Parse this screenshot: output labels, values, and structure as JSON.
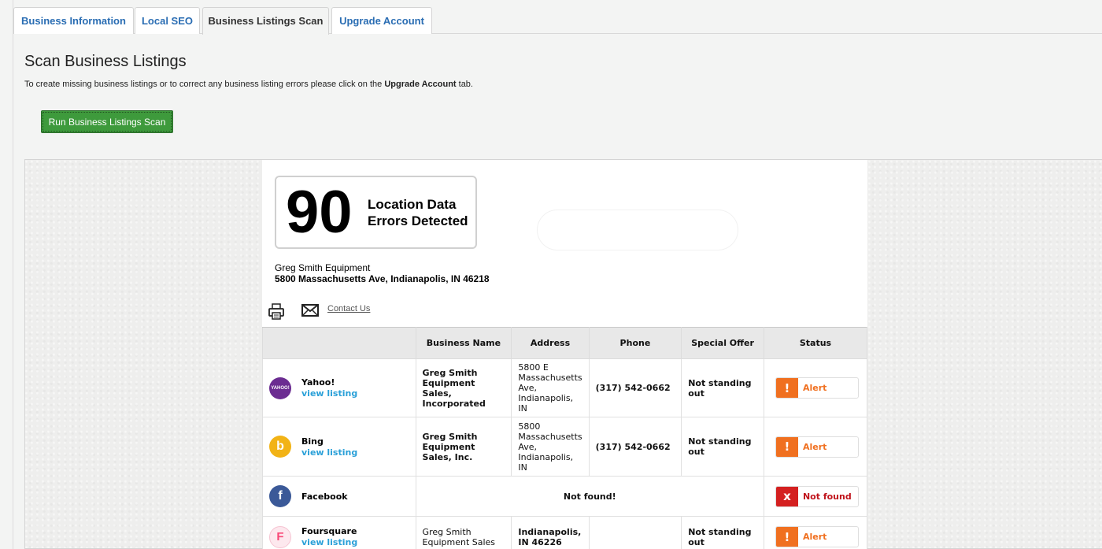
{
  "tabs": [
    {
      "label": "Business Information"
    },
    {
      "label": "Local SEO"
    },
    {
      "label": "Business Listings Scan"
    },
    {
      "label": "Upgrade Account"
    }
  ],
  "page": {
    "title": "Scan Business Listings",
    "instruction_pre": "To create missing business listings or to correct any business listing errors please click on the ",
    "instruction_bold": "Upgrade Account",
    "instruction_post": " tab.",
    "run_button": "Run Business Listings Scan"
  },
  "report": {
    "error_count": "90",
    "error_label_line1": "Location Data",
    "error_label_line2": "Errors Detected",
    "business_name": "Greg Smith Equipment",
    "business_address": "5800 Massachusetts Ave, Indianapolis, IN 46218",
    "contact_link": "Contact Us"
  },
  "table": {
    "headers": [
      "",
      "Business Name",
      "Address",
      "Phone",
      "Special Offer",
      "Status"
    ],
    "rows": [
      {
        "site": "Yahoo!",
        "logo_text": "YAHOO!",
        "view": "view listing",
        "name": "Greg Smith Equipment Sales, Incorporated",
        "address": "5800 E Massachusetts Ave, Indianapolis, IN",
        "phone": "(317) 542-0662",
        "offer": "Not standing out",
        "status": "Alert"
      },
      {
        "site": "Bing",
        "logo_text": "b",
        "view": "view listing",
        "name": "Greg Smith Equipment Sales, Inc.",
        "address": "5800 Massachusetts Ave, Indianapolis, IN",
        "phone": "(317) 542-0662",
        "offer": "Not standing out",
        "status": "Alert"
      },
      {
        "site": "Facebook",
        "logo_text": "f",
        "notfound": "Not found!",
        "status": "Not found"
      },
      {
        "site": "Foursquare",
        "logo_text": "F",
        "view": "view listing",
        "name": "Greg Smith Equipment Sales",
        "address": "Indianapolis, IN 46226",
        "phone": "",
        "offer": "Not standing out",
        "status": "Alert"
      }
    ]
  },
  "colors": {
    "tab_link": "#2a6db3",
    "run_button": "#3e9a3c",
    "error_red": "#c0131b",
    "alert_orange": "#f07020",
    "link_blue": "#2aa0d8",
    "yahoo": "#6b2c91",
    "bing": "#f2b316",
    "facebook": "#3b5998",
    "foursquare": "#f94877"
  },
  "icons": {
    "print": "printer-icon",
    "mail": "envelope-icon",
    "alert": "exclamation-icon",
    "notfound": "x-icon"
  }
}
